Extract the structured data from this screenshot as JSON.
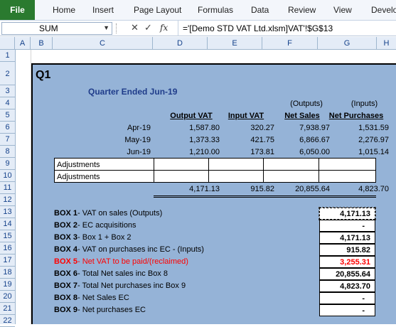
{
  "ribbon": {
    "file": "File",
    "tabs": [
      "Home",
      "Insert",
      "Page Layout",
      "Formulas",
      "Data",
      "Review",
      "View",
      "Develo"
    ]
  },
  "formula_bar": {
    "name_box": "SUM",
    "formula": "='[Demo STD VAT Ltd.xlsm]VAT'!$G$13"
  },
  "columns": [
    "A",
    "B",
    "C",
    "D",
    "E",
    "F",
    "G",
    "H"
  ],
  "rows": [
    "1",
    "2",
    "3",
    "4",
    "5",
    "6",
    "7",
    "8",
    "9",
    "10",
    "11",
    "12",
    "13",
    "14",
    "15",
    "16",
    "17",
    "18",
    "19",
    "20",
    "21",
    "22"
  ],
  "sheet": {
    "title": "Q1",
    "subtitle": "Quarter Ended  Jun-19",
    "headers_top": {
      "outputs": "(Outputs)",
      "inputs": "(Inputs)"
    },
    "headers": {
      "output_vat": "Output VAT",
      "input_vat": "Input VAT",
      "net_sales": "Net Sales",
      "net_purchases": "Net Purchases"
    },
    "months": [
      {
        "label": "Apr-19",
        "output_vat": "1,587.80",
        "input_vat": "320.27",
        "net_sales": "7,938.97",
        "net_purchases": "1,531.59"
      },
      {
        "label": "May-19",
        "output_vat": "1,373.33",
        "input_vat": "421.75",
        "net_sales": "6,866.67",
        "net_purchases": "2,276.97"
      },
      {
        "label": "Jun-19",
        "output_vat": "1,210.00",
        "input_vat": "173.81",
        "net_sales": "6,050.00",
        "net_purchases": "1,015.14"
      }
    ],
    "adjustments": [
      "Adjustments",
      "Adjustments"
    ],
    "totals": {
      "output_vat": "4,171.13",
      "input_vat": "915.82",
      "net_sales": "20,855.64",
      "net_purchases": "4,823.70"
    },
    "boxes": [
      {
        "key": "BOX 1",
        "desc": " - VAT on sales (Outputs)",
        "value": "4,171.13"
      },
      {
        "key": "BOX 2",
        "desc": " - EC acquisitions",
        "value": "-"
      },
      {
        "key": "BOX 3",
        "desc": " - Box 1 + Box 2",
        "value": "4,171.13"
      },
      {
        "key": "BOX 4",
        "desc": " - VAT on purchases inc EC - (Inputs)",
        "value": "915.82"
      },
      {
        "key": "BOX 5",
        "desc": " - Net VAT to be paid/(reclaimed)",
        "value": "3,255.31"
      },
      {
        "key": "BOX 6",
        "desc": " - Total Net sales inc Box 8",
        "value": "20,855.64"
      },
      {
        "key": "BOX 7",
        "desc": " - Total Net purchases inc Box 9",
        "value": "4,823.70"
      },
      {
        "key": "BOX 8",
        "desc": " - Net Sales EC",
        "value": "-"
      },
      {
        "key": "BOX 9",
        "desc": " - Net purchases EC",
        "value": "-"
      }
    ]
  },
  "colors": {
    "sheet_fill": "#95b3d7",
    "title_blue": "#1f3c8a",
    "box5_red": "#ff0000",
    "file_green": "#2a7a2f"
  }
}
